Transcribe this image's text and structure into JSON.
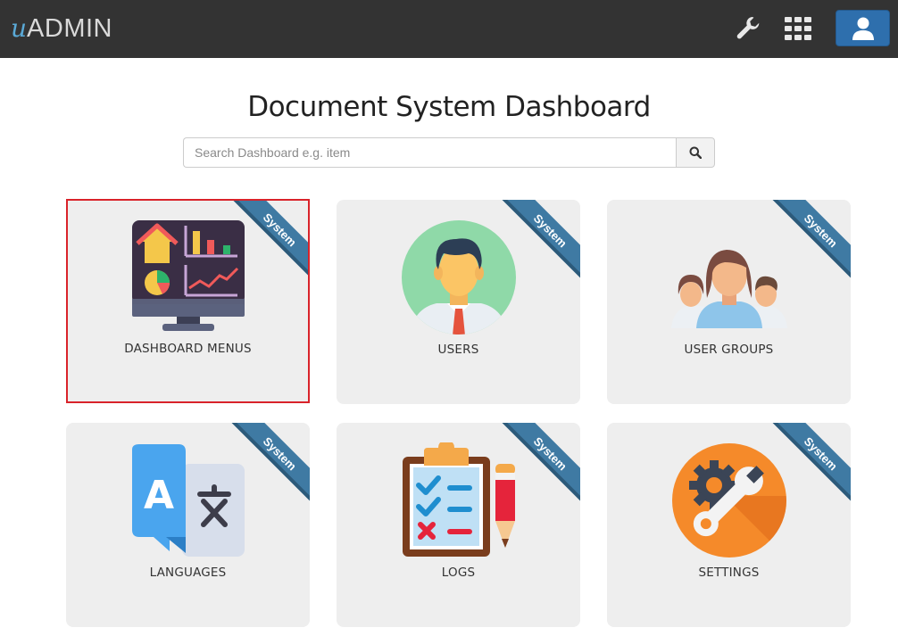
{
  "header": {
    "logo_mark": "u",
    "logo_text": "ADMIN",
    "icons": [
      "wrench-icon",
      "grid-icon",
      "user-icon"
    ]
  },
  "title": "Document System Dashboard",
  "search": {
    "placeholder": "Search Dashboard e.g. item",
    "value": ""
  },
  "tiles": [
    {
      "label": "DASHBOARD MENUS",
      "ribbon": "System",
      "icon": "dashboard-monitor-icon",
      "selected": true
    },
    {
      "label": "USERS",
      "ribbon": "System",
      "icon": "user-avatar-icon"
    },
    {
      "label": "USER GROUPS",
      "ribbon": "System",
      "icon": "user-group-icon"
    },
    {
      "label": "LANGUAGES",
      "ribbon": "System",
      "icon": "translate-icon"
    },
    {
      "label": "LOGS",
      "ribbon": "System",
      "icon": "clipboard-checklist-icon"
    },
    {
      "label": "SETTINGS",
      "ribbon": "System",
      "icon": "wrench-gear-icon"
    }
  ],
  "colors": {
    "topbar": "#333333",
    "ribbon": "#3f7aa3",
    "selected_border": "#d9232a",
    "user_button": "#2e6fad"
  }
}
